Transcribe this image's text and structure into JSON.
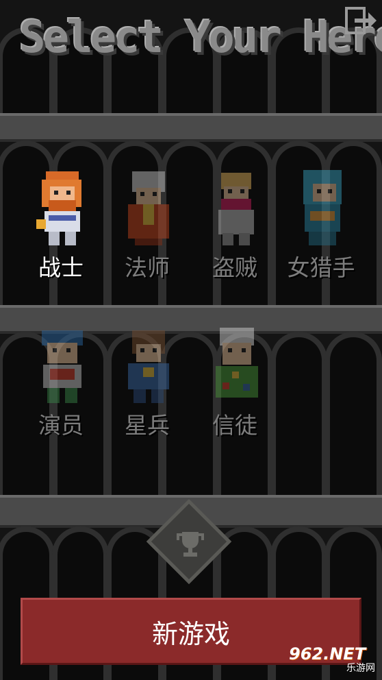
{
  "title": "Select Your Hero",
  "heroes_row1": [
    {
      "name": "战士",
      "locked": false
    },
    {
      "name": "法师",
      "locked": true
    },
    {
      "name": "盗贼",
      "locked": true
    },
    {
      "name": "女猎手",
      "locked": true
    }
  ],
  "heroes_row2": [
    {
      "name": "演员",
      "locked": true
    },
    {
      "name": "星兵",
      "locked": true
    },
    {
      "name": "信徒",
      "locked": true
    }
  ],
  "new_game_label": "新游戏",
  "watermark": {
    "main": "962.NET",
    "sub": "乐游网"
  },
  "colors": {
    "button": "#8b2a2a",
    "title": "#8a8a8a",
    "stone": "#4a4a4a"
  },
  "icons": [
    "exit-icon",
    "trophy-icon"
  ]
}
